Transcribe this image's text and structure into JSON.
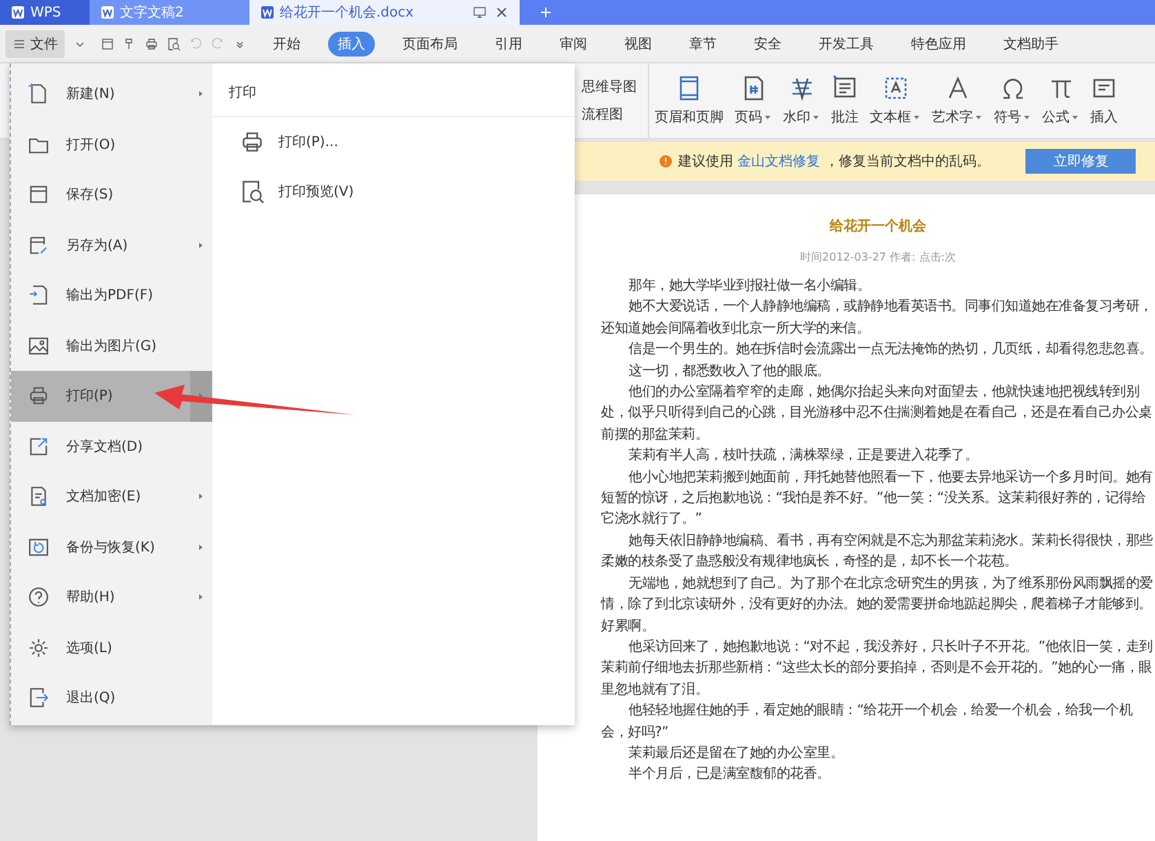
{
  "tabs": [
    {
      "label": "WPS",
      "kind": "home",
      "selected": false
    },
    {
      "label": "文字文稿2",
      "kind": "doc",
      "selected": false
    },
    {
      "label": "给花开一个机会.docx",
      "kind": "doc",
      "selected": true
    }
  ],
  "menu_button": {
    "label": "文件"
  },
  "ribbon_tabs": [
    {
      "label": "开始",
      "selected": false
    },
    {
      "label": "插入",
      "selected": true
    },
    {
      "label": "页面布局",
      "selected": false
    },
    {
      "label": "引用",
      "selected": false
    },
    {
      "label": "审阅",
      "selected": false
    },
    {
      "label": "视图",
      "selected": false
    },
    {
      "label": "章节",
      "selected": false
    },
    {
      "label": "安全",
      "selected": false
    },
    {
      "label": "开发工具",
      "selected": false
    },
    {
      "label": "特色应用",
      "selected": false
    },
    {
      "label": "文档助手",
      "selected": false
    }
  ],
  "ribbon_small": [
    "思维导图",
    "流程图"
  ],
  "ribbon_tools": [
    {
      "label": "页眉和页脚",
      "kind": "header",
      "dropdown": false
    },
    {
      "label": "页码",
      "kind": "page-number",
      "dropdown": true
    },
    {
      "label": "水印",
      "kind": "watermark",
      "dropdown": true
    },
    {
      "label": "批注",
      "kind": "comment",
      "dropdown": false
    },
    {
      "label": "文本框",
      "kind": "textbox",
      "dropdown": true
    },
    {
      "label": "艺术字",
      "kind": "wordart",
      "dropdown": true
    },
    {
      "label": "符号",
      "kind": "symbol",
      "dropdown": true
    },
    {
      "label": "公式",
      "kind": "formula",
      "dropdown": true
    },
    {
      "label": "插入",
      "kind": "insert",
      "dropdown": false
    }
  ],
  "notice": {
    "text": "建议使用 ",
    "link": "金山文档修复",
    "text_after": " ，修复当前文档中的乱码。",
    "button": "立即修复"
  },
  "file_menu": [
    {
      "label": "新建(N)",
      "kind": "new",
      "submenu": true,
      "selected": false
    },
    {
      "label": "打开(O)",
      "kind": "open",
      "submenu": false,
      "selected": false
    },
    {
      "label": "保存(S)",
      "kind": "save",
      "submenu": false,
      "selected": false
    },
    {
      "label": "另存为(A)",
      "kind": "saveas",
      "submenu": true,
      "selected": false
    },
    {
      "label": "输出为PDF(F)",
      "kind": "pdf",
      "submenu": false,
      "selected": false
    },
    {
      "label": "输出为图片(G)",
      "kind": "image",
      "submenu": false,
      "selected": false
    },
    {
      "label": "打印(P)",
      "kind": "print",
      "submenu": true,
      "selected": true
    },
    {
      "label": "分享文档(D)",
      "kind": "share",
      "submenu": false,
      "selected": false
    },
    {
      "label": "文档加密(E)",
      "kind": "encrypt",
      "submenu": true,
      "selected": false
    },
    {
      "label": "备份与恢复(K)",
      "kind": "backup",
      "submenu": true,
      "selected": false
    },
    {
      "label": "帮助(H)",
      "kind": "help",
      "submenu": true,
      "selected": false
    },
    {
      "label": "选项(L)",
      "kind": "options",
      "submenu": false,
      "selected": false
    },
    {
      "label": "退出(Q)",
      "kind": "exit",
      "submenu": false,
      "selected": false
    }
  ],
  "submenu": {
    "title": "打印",
    "items": [
      {
        "label": "打印(P)...",
        "kind": "print"
      },
      {
        "label": "打印预览(V)",
        "kind": "preview"
      }
    ]
  },
  "document": {
    "title": "给花开一个机会",
    "meta": "时间2012-03-27 作者: 点击:次",
    "paragraphs": [
      "那年，她大学毕业到报社做一名小编辑。",
      "她不大爱说话，一个人静静地编稿，或静静地看英语书。同事们知道她在准备复习考研，还知道她会间隔着收到北京一所大学的来信。",
      "信是一个男生的。她在拆信时会流露出一点无法掩饰的热切，几页纸，却看得忽悲忽喜。",
      "这一切，都悉数收入了他的眼底。",
      "他们的办公室隔着窄窄的走廊，她偶尔抬起头来向对面望去，他就快速地把视线转到别处，似乎只听得到自己的心跳，目光游移中忍不住揣测着她是在看自己，还是在看自己办公桌前摆的那盆茉莉。",
      "茉莉有半人高，枝叶扶疏，满株翠绿，正是要进入花季了。",
      "他小心地把茉莉搬到她面前，拜托她替他照看一下，他要去异地采访一个多月时间。她有短暂的惊讶，之后抱歉地说：“我怕是养不好。”他一笑：“没关系。这茉莉很好养的，记得给它浇水就行了。”",
      "她每天依旧静静地编稿、看书，再有空闲就是不忘为那盆茉莉浇水。茉莉长得很快，那些柔嫩的枝条受了蛊惑般没有规律地疯长，奇怪的是，却不长一个花苞。",
      "无端地，她就想到了自己。为了那个在北京念研究生的男孩，为了维系那份风雨飘摇的爱情，除了到北京读研外，没有更好的办法。她的爱需要拼命地踮起脚尖，爬着梯子才能够到。好累啊。",
      "他采访回来了，她抱歉地说：“对不起，我没养好，只长叶子不开花。”他依旧一笑，走到茉莉前仔细地去折那些新梢：“这些太长的部分要掐掉，否则是不会开花的。”她的心一痛，眼里忽地就有了泪。",
      "他轻轻地握住她的手，看定她的眼睛：“给花开一个机会，给爱一个机会，给我一个机会，好吗?”",
      "茉莉最后还是留在了她的办公室里。",
      "半个月后，已是满室馥郁的花香。"
    ]
  }
}
